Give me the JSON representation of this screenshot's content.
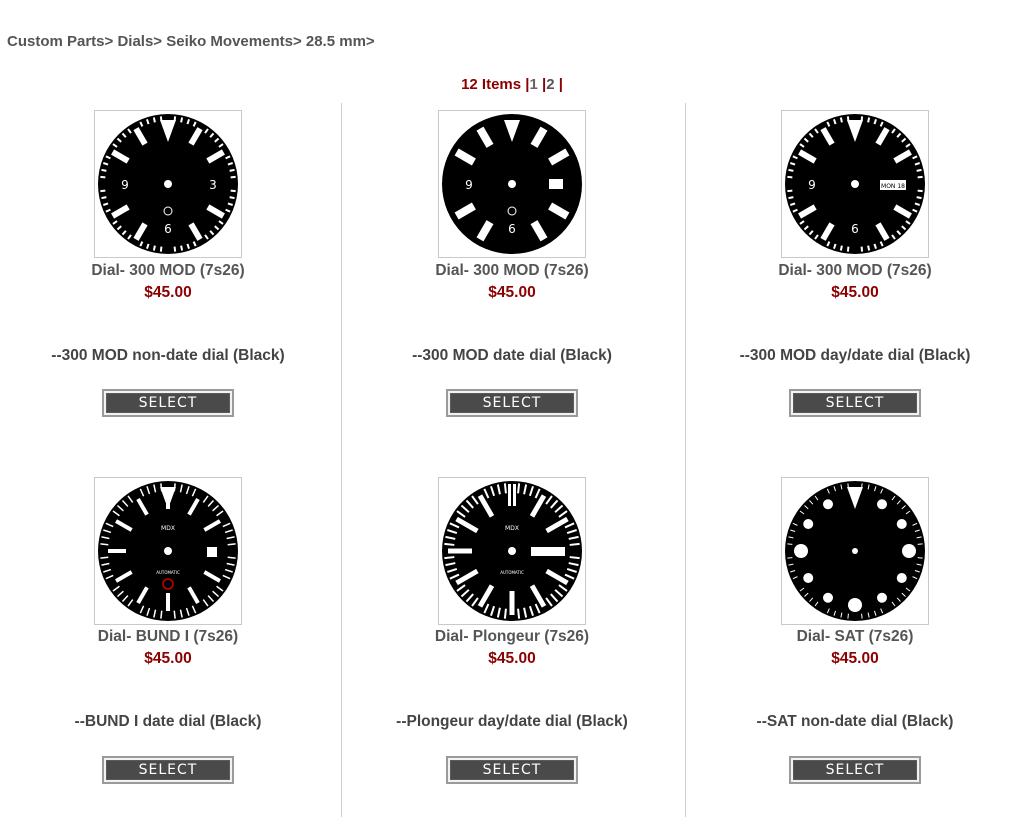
{
  "breadcrumb": [
    {
      "label": "Custom Parts> "
    },
    {
      "label": "Dials> "
    },
    {
      "label": "Seiko Movements> "
    },
    {
      "label": "28.5 mm> "
    }
  ],
  "pager": {
    "count_text": "12 Items ",
    "sep1": "|",
    "page1": "1",
    "sep2": " |",
    "page2": "2",
    "sep3": " |"
  },
  "colors": {
    "price": "#8b0000",
    "text": "#555555",
    "button": "#4a4a4a"
  },
  "products": [
    {
      "name": "Dial- 300 MOD (7s26)",
      "price": "$45.00",
      "desc": "--300 MOD non-date dial (Black)",
      "button": "SELECT",
      "icon": "dial-300-mod-non-date-icon"
    },
    {
      "name": "Dial- 300 MOD (7s26)",
      "price": "$45.00",
      "desc": "--300 MOD date dial (Black)",
      "button": "SELECT",
      "icon": "dial-300-mod-date-icon"
    },
    {
      "name": "Dial- 300 MOD (7s26)",
      "price": "$45.00",
      "desc": "--300 MOD day/date dial (Black)",
      "button": "SELECT",
      "icon": "dial-300-mod-day-date-icon"
    },
    {
      "name": "Dial- BUND I (7s26)",
      "price": "$45.00",
      "desc": "--BUND I date dial (Black)",
      "button": "SELECT",
      "icon": "dial-bund-i-icon"
    },
    {
      "name": "Dial- Plongeur (7s26)",
      "price": "$45.00",
      "desc": "--Plongeur day/date dial (Black)",
      "button": "SELECT",
      "icon": "dial-plongeur-icon"
    },
    {
      "name": "Dial- SAT (7s26)",
      "price": "$45.00",
      "desc": "--SAT non-date dial (Black)",
      "button": "SELECT",
      "icon": "dial-sat-icon"
    }
  ]
}
